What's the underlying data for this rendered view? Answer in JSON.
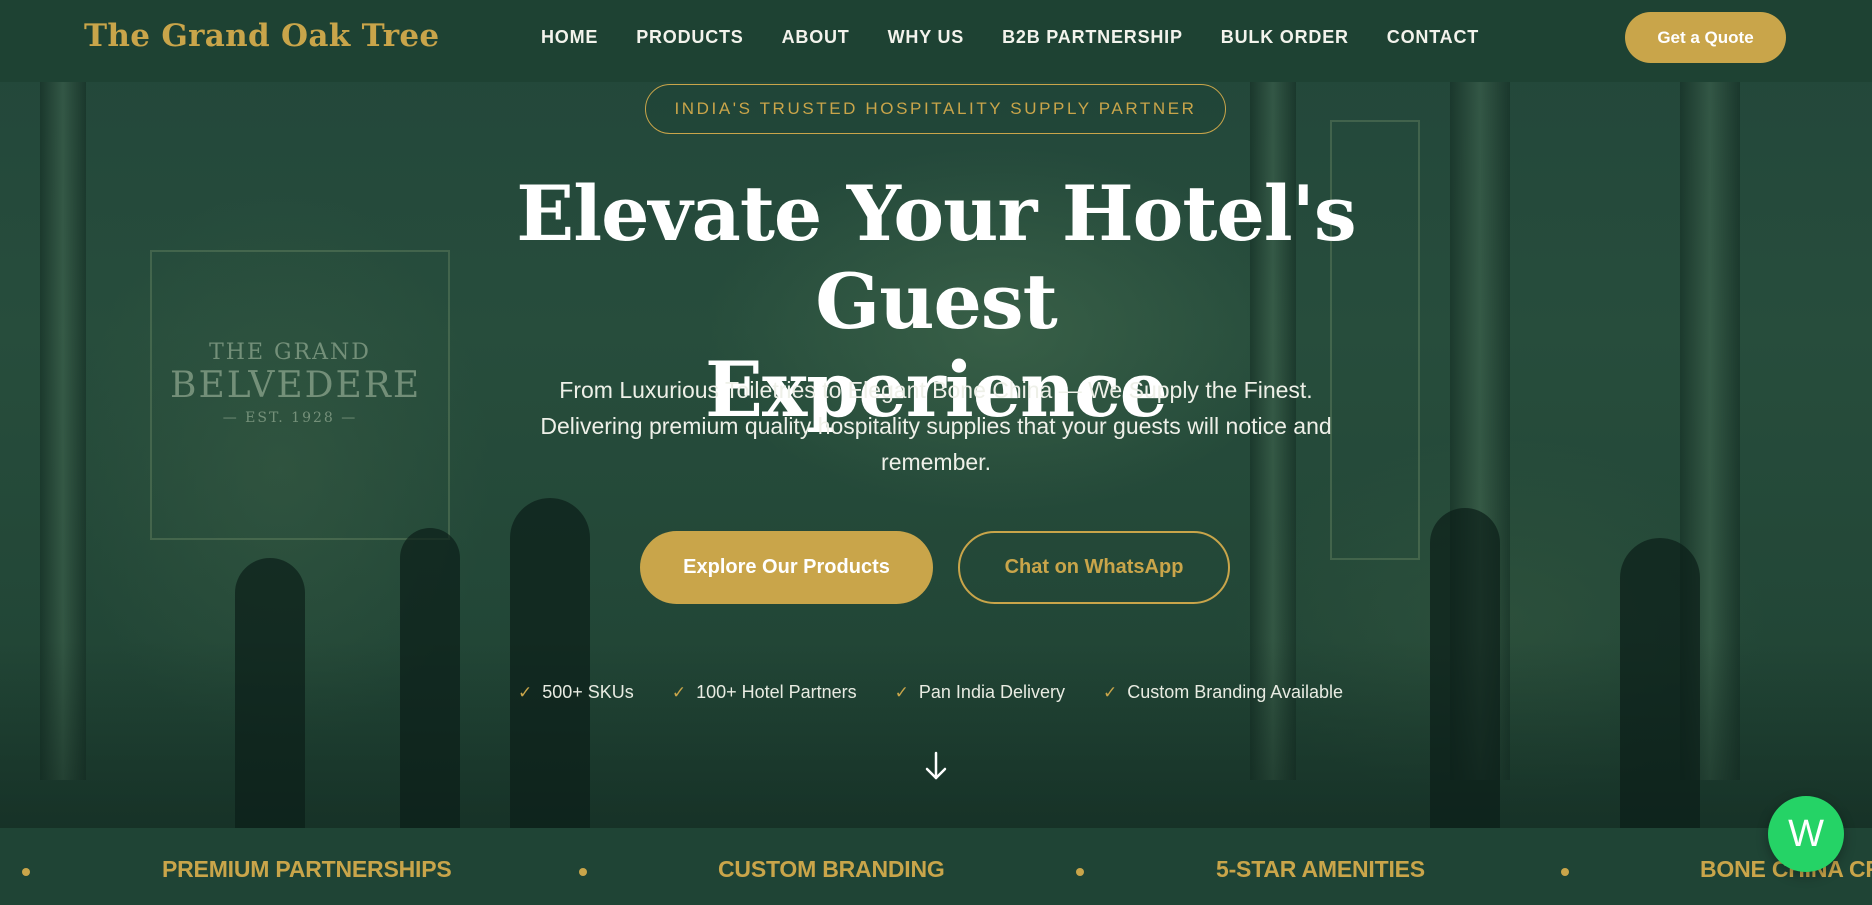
{
  "header": {
    "logo": "The Grand Oak Tree",
    "nav": [
      "HOME",
      "PRODUCTS",
      "ABOUT",
      "WHY US",
      "B2B PARTNERSHIP",
      "BULK ORDER",
      "CONTACT"
    ],
    "cta": "Get a Quote"
  },
  "hero": {
    "badge": "INDIA'S TRUSTED HOSPITALITY SUPPLY PARTNER",
    "title_line1": "Elevate Your Hotel's Guest",
    "title_line2": "Experience",
    "subtitle_line1": "From Luxurious Toiletries to Elegant Bone China — We Supply the Finest.",
    "subtitle_line2": "Delivering premium quality hospitality supplies that your guests will notice and",
    "subtitle_line3": "remember.",
    "primary_button": "Explore Our Products",
    "secondary_button": "Chat on WhatsApp",
    "features": [
      "500+ SKUs",
      "100+ Hotel Partners",
      "Pan India Delivery",
      "Custom Branding Available"
    ],
    "background_sign": {
      "line1": "THE GRAND",
      "line2": "BELVEDERE",
      "line3": "— EST. 1928 —"
    }
  },
  "band": {
    "items": [
      "PREMIUM PARTNERSHIPS",
      "CUSTOM BRANDING",
      "5-STAR AMENITIES",
      "BONE CHINA CR"
    ]
  },
  "floating": {
    "whatsapp_label": "W"
  },
  "colors": {
    "brand_green": "#1e4233",
    "gold": "#c9a54a",
    "whatsapp": "#25d366"
  }
}
